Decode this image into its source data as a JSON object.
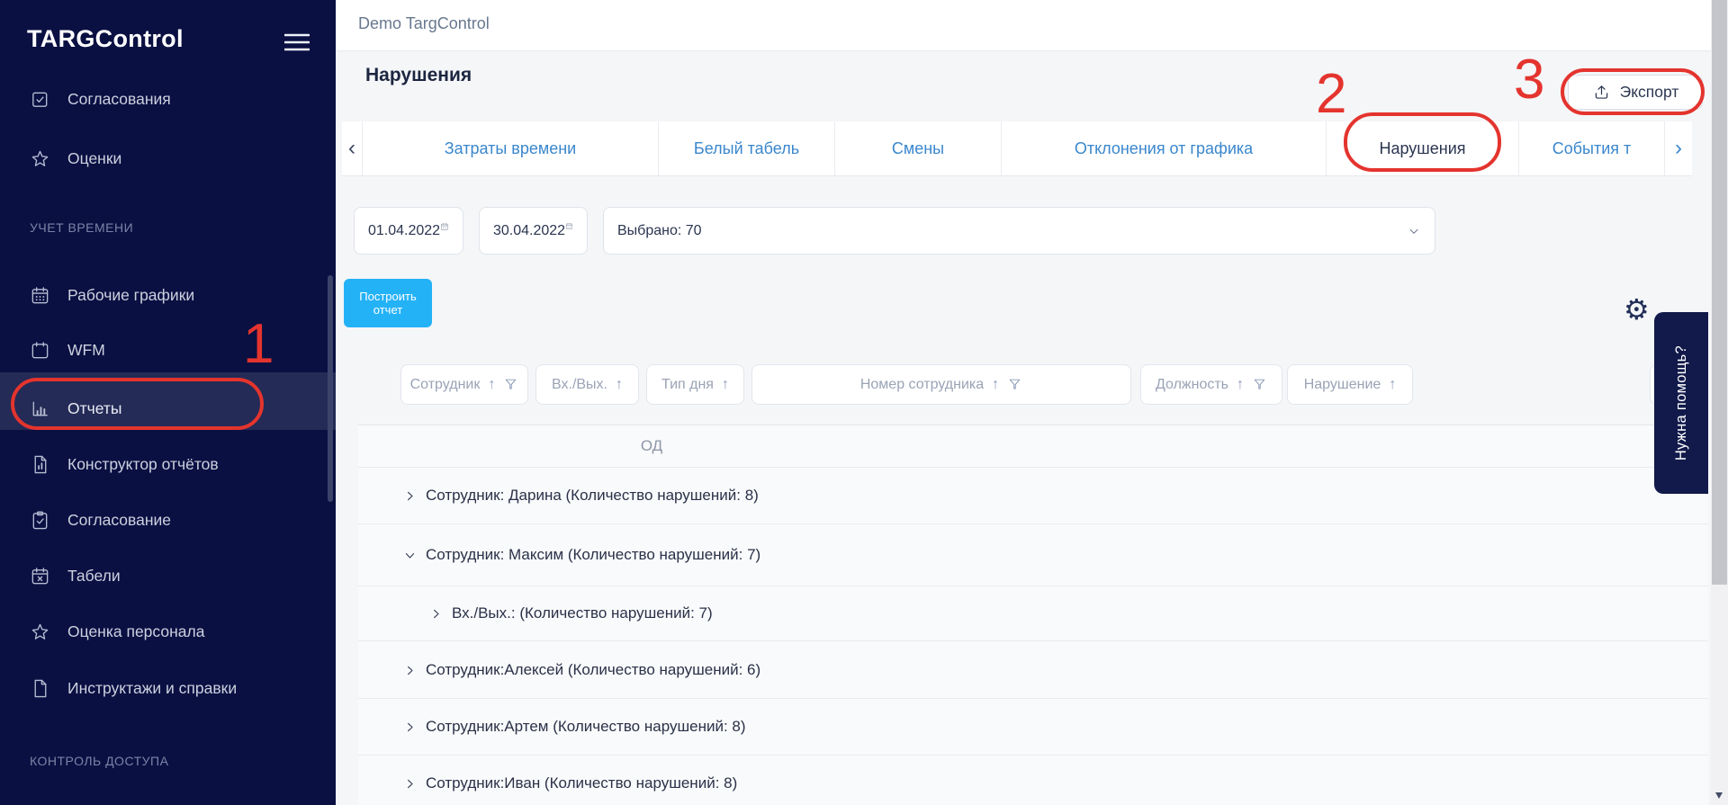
{
  "colors": {
    "sidebar_bg": "#0a1042",
    "accent_blue": "#24b2f7",
    "tab_link_blue": "#3a87cd",
    "annotation_red": "#e4342e",
    "help_tab_bg": "#111a4a"
  },
  "sidebar": {
    "logo": "TARGControl",
    "items": [
      {
        "label": "Согласования",
        "icon": "checkbox-check-icon"
      },
      {
        "label": "Оценки",
        "icon": "star-icon"
      },
      {
        "label": "УЧЕТ ВРЕМЕНИ",
        "type": "section"
      },
      {
        "label": "Рабочие графики",
        "icon": "calendar-grid-icon"
      },
      {
        "label": "WFM",
        "icon": "calendar-icon"
      },
      {
        "label": "Отчеты",
        "icon": "bar-chart-icon",
        "active": true
      },
      {
        "label": "Конструктор отчётов",
        "icon": "document-chart-icon"
      },
      {
        "label": "Согласование",
        "icon": "clipboard-check-icon"
      },
      {
        "label": "Табели",
        "icon": "calendar-x-icon"
      },
      {
        "label": "Оценка персонала",
        "icon": "star-icon"
      },
      {
        "label": "Инструктажи и справки",
        "icon": "document-icon"
      },
      {
        "label": "КОНТРОЛЬ ДОСТУПА",
        "type": "section"
      }
    ]
  },
  "topbar": {
    "workspace": "Demo TargControl"
  },
  "page": {
    "title": "Нарушения",
    "export": "Экспорт"
  },
  "tabs": {
    "scroll_left": "‹",
    "scroll_right": "›",
    "items": [
      {
        "label": "Затраты времени",
        "active": false
      },
      {
        "label": "Белый табель",
        "active": false
      },
      {
        "label": "Смены",
        "active": false
      },
      {
        "label": "Отклонения от графика",
        "active": false
      },
      {
        "label": "Нарушения",
        "active": true
      },
      {
        "label": "События т",
        "active": false
      }
    ]
  },
  "filters": {
    "date_from": "01.04.2022",
    "date_to": "30.04.2022",
    "employees_selected": "Выбрано: 70",
    "build_report": "Построить отчет"
  },
  "table": {
    "columns": [
      {
        "label": "Сотрудник",
        "sort": "↑",
        "filter": true
      },
      {
        "label": "Вх./Вых.",
        "sort": "↑",
        "filter": false
      },
      {
        "label": "Тип дня",
        "sort": "↑",
        "filter": false
      },
      {
        "label": "Номер сотрудника",
        "sort": "↑",
        "filter": true
      },
      {
        "label": "Должность",
        "sort": "↑",
        "filter": true
      },
      {
        "label": "Нарушение",
        "sort": "↑",
        "filter": false
      }
    ],
    "group_header": "ОД",
    "rows": [
      {
        "label": "Сотрудник: Дарина (Количество нарушений: 8)",
        "expanded": false,
        "nested": false
      },
      {
        "label": "Сотрудник: Максим (Количество нарушений: 7)",
        "expanded": true,
        "nested": false
      },
      {
        "label": "Вх./Вых.: (Количество нарушений: 7)",
        "expanded": false,
        "nested": true
      },
      {
        "label": "Сотрудник:Алексей (Количество нарушений: 6)",
        "expanded": false,
        "nested": false
      },
      {
        "label": "Сотрудник:Артем (Количество нарушений: 8)",
        "expanded": false,
        "nested": false
      },
      {
        "label": "Сотрудник:Иван (Количество нарушений: 8)",
        "expanded": false,
        "nested": false
      }
    ]
  },
  "help": {
    "label": "Нужна помощь?"
  },
  "annotations": {
    "step_1": "1",
    "step_2": "2",
    "step_3": "3"
  }
}
